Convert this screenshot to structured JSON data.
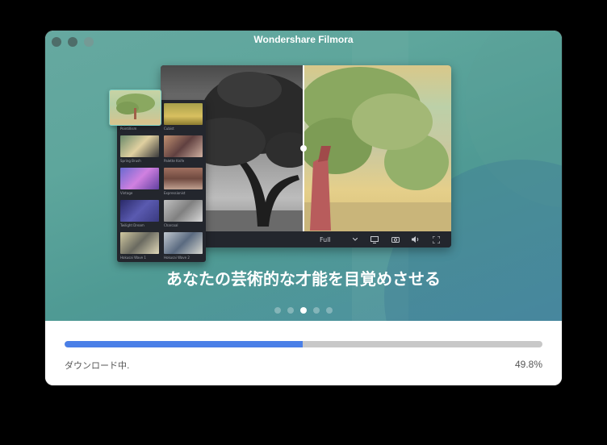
{
  "window": {
    "title": "Wondershare Filmora"
  },
  "hero": {
    "tagline": "あなたの芸術的な才能を目覚めさせる",
    "carousel": {
      "count": 5,
      "active_index": 2
    }
  },
  "editor": {
    "quality_label": "Full",
    "icons": [
      "play-icon",
      "stop-icon",
      "chevron-down-icon",
      "monitor-icon",
      "camera-icon",
      "volume-icon",
      "fullscreen-icon"
    ]
  },
  "effects": {
    "selected": {
      "label": "Pointillism"
    },
    "items": [
      {
        "label": "Cubist"
      },
      {
        "label": "Spring Brush"
      },
      {
        "label": "Palette Knife"
      },
      {
        "label": "Vintage"
      },
      {
        "label": "Expressionist"
      },
      {
        "label": "Twilight Dream"
      },
      {
        "label": "Charcoal"
      },
      {
        "label": "Hokusai Wave 1"
      },
      {
        "label": "Hokusai Wave 2"
      }
    ]
  },
  "download": {
    "status": "ダウンロード中.",
    "percent_label": "49.8%",
    "progress": 0.498
  },
  "colors": {
    "accent": "#4a7fe7",
    "track": "#c8c8c8",
    "hero_top": "#66a8a0",
    "hero_bottom": "#4e8fa3"
  }
}
